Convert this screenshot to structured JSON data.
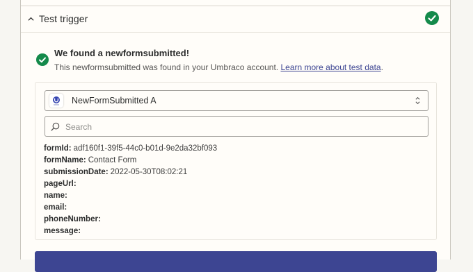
{
  "section": {
    "title": "Test trigger",
    "status_icon": "check-circle-icon",
    "accent_color": "#148a4b"
  },
  "result": {
    "title": "We found a newformsubmitted!",
    "description": "This newformsubmitted was found in your Umbraco account. ",
    "link_text": "Learn more about test data",
    "description_end": "."
  },
  "sample_select": {
    "icon": "umbraco-logo-icon",
    "selected": "NewFormSubmitted A"
  },
  "search": {
    "placeholder": "Search",
    "value": ""
  },
  "fields": [
    {
      "key": "formId:",
      "value": "adf160f1-39f5-44c0-b01d-9e2da32bf093"
    },
    {
      "key": "formName:",
      "value": "Contact Form"
    },
    {
      "key": "submissionDate:",
      "value": "2022-05-30T08:02:21"
    },
    {
      "key": "pageUrl:",
      "value": ""
    },
    {
      "key": "name:",
      "value": ""
    },
    {
      "key": "email:",
      "value": ""
    },
    {
      "key": "phoneNumber:",
      "value": ""
    },
    {
      "key": "message:",
      "value": ""
    }
  ],
  "colors": {
    "link": "#3d4592",
    "primary_button": "#3d4592"
  }
}
